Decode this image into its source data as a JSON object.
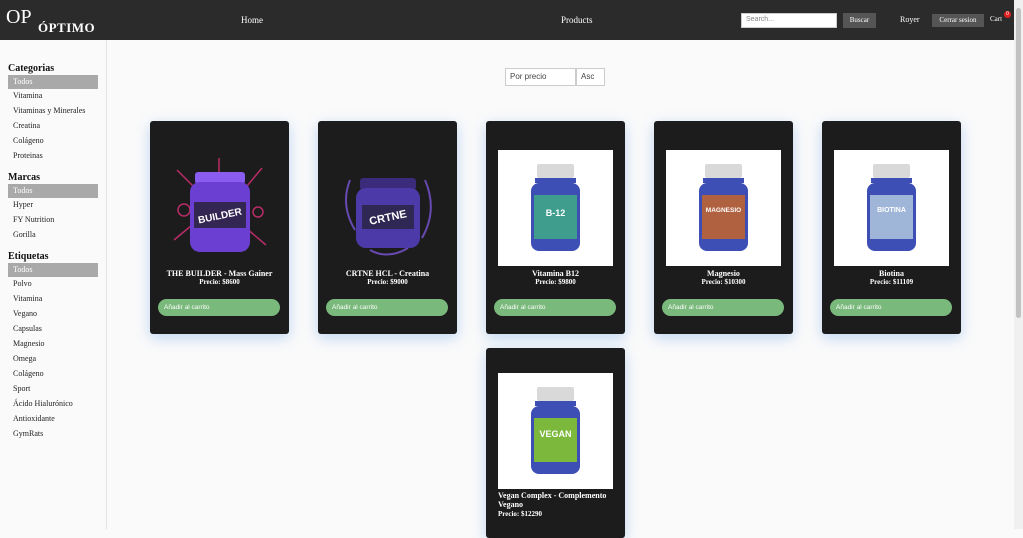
{
  "header": {
    "logo_mark": "OP",
    "logo_text": "ÓPTIMO",
    "nav": [
      {
        "label": "Home"
      },
      {
        "label": "Products"
      }
    ],
    "search_placeholder": "Search...",
    "search_button": "Buscar",
    "user_name": "Royer",
    "logout_button": "Cerrar sesion",
    "cart_label": "Cart",
    "cart_count": "0"
  },
  "sidebar": {
    "categories": {
      "title": "Categorias",
      "items": [
        "Todos",
        "Vitamina",
        "Vitaminas y Minerales",
        "Creatina",
        "Colágeno",
        "Proteinas"
      ]
    },
    "brands": {
      "title": "Marcas",
      "items": [
        "Todos",
        "Hyper",
        "FY Nutrition",
        "Gorilla"
      ]
    },
    "tags": {
      "title": "Etiquetas",
      "items": [
        "Todos",
        "Polvo",
        "Vitamina",
        "Vegano",
        "Capsulas",
        "Magnesio",
        "Omega",
        "Colágeno",
        "Sport",
        "Ácido Hialurónico",
        "Antioxidante",
        "GymRats"
      ]
    }
  },
  "sort": {
    "field": "Por precio",
    "order": "Asc"
  },
  "products": [
    {
      "name": "THE BUILDER - Mass Gainer",
      "price": "Precio: $8600",
      "button": "Añadir al carrito",
      "image_label": "BUILDER",
      "color": "#6a3fd1"
    },
    {
      "name": "CRTNE HCL - Creatina",
      "price": "Precio: $9000",
      "button": "Añadir al carrito",
      "image_label": "CRTNE",
      "color": "#4b3aa8"
    },
    {
      "name": "Vitamina B12",
      "price": "Precio: $9800",
      "button": "Añadir al carrito",
      "image_label": "B-12",
      "color": "#3f9d8e"
    },
    {
      "name": "Magnesio",
      "price": "Precio: $10300",
      "button": "Añadir al carrito",
      "image_label": "MAGNESIO",
      "color": "#b0613f"
    },
    {
      "name": "Biotina",
      "price": "Precio: $11109",
      "button": "Añadir al carrito",
      "image_label": "BIOTINA",
      "color": "#9fb6d8"
    },
    {
      "name": "Vegan Complex - Complemento Vegano",
      "price": "Precio: $12290",
      "button": "Añadir al carrito",
      "image_label": "VEGAN",
      "color": "#7bb83c"
    }
  ]
}
